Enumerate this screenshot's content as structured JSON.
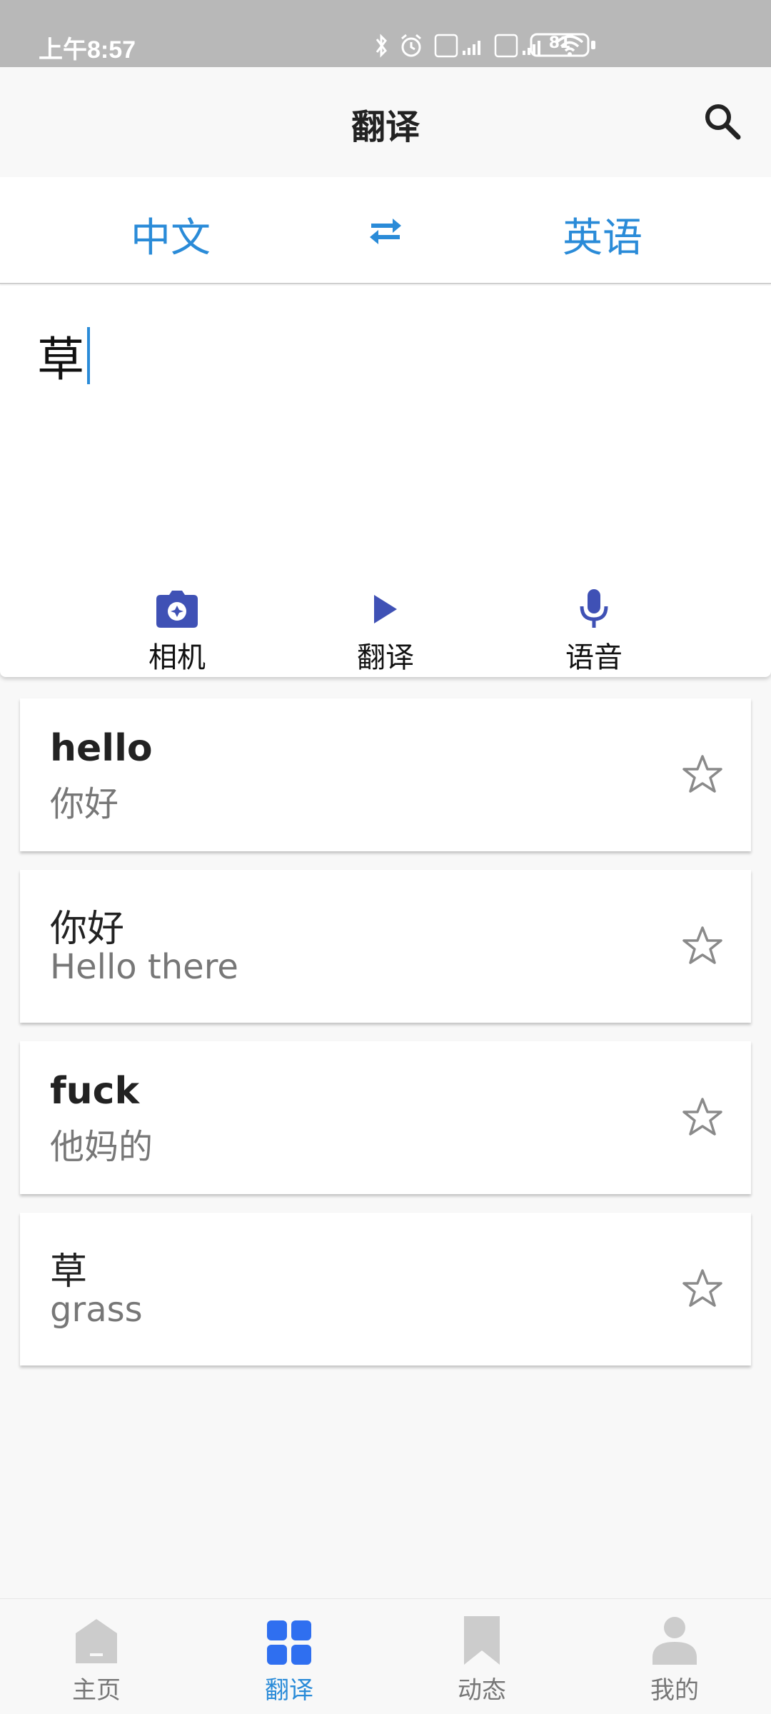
{
  "status_bar": {
    "time": "上午8:57",
    "battery": "81"
  },
  "app_bar": {
    "title": "翻译"
  },
  "language_bar": {
    "source": "中文",
    "target": "英语"
  },
  "input": {
    "text": "草"
  },
  "actions": [
    {
      "label": "相机",
      "icon": "camera-icon"
    },
    {
      "label": "翻译",
      "icon": "play-icon"
    },
    {
      "label": "语音",
      "icon": "microphone-icon"
    }
  ],
  "history": [
    {
      "source": "hello",
      "translation": "你好"
    },
    {
      "source": "你好",
      "translation": "Hello there"
    },
    {
      "source": "fuck",
      "translation": "他妈的"
    },
    {
      "source": "草",
      "translation": "grass"
    }
  ],
  "bottom_nav": {
    "items": [
      {
        "label": "主页",
        "icon": "home-icon",
        "active": false
      },
      {
        "label": "翻译",
        "icon": "grid-icon",
        "active": true
      },
      {
        "label": "动态",
        "icon": "bookmark-icon",
        "active": false
      },
      {
        "label": "我的",
        "icon": "person-icon",
        "active": false
      }
    ]
  },
  "colors": {
    "accent": "#2a8bd8",
    "action_icon": "#3f51b5",
    "nav_inactive": "#c8c8c8",
    "nav_active": "#2f6ff0"
  }
}
